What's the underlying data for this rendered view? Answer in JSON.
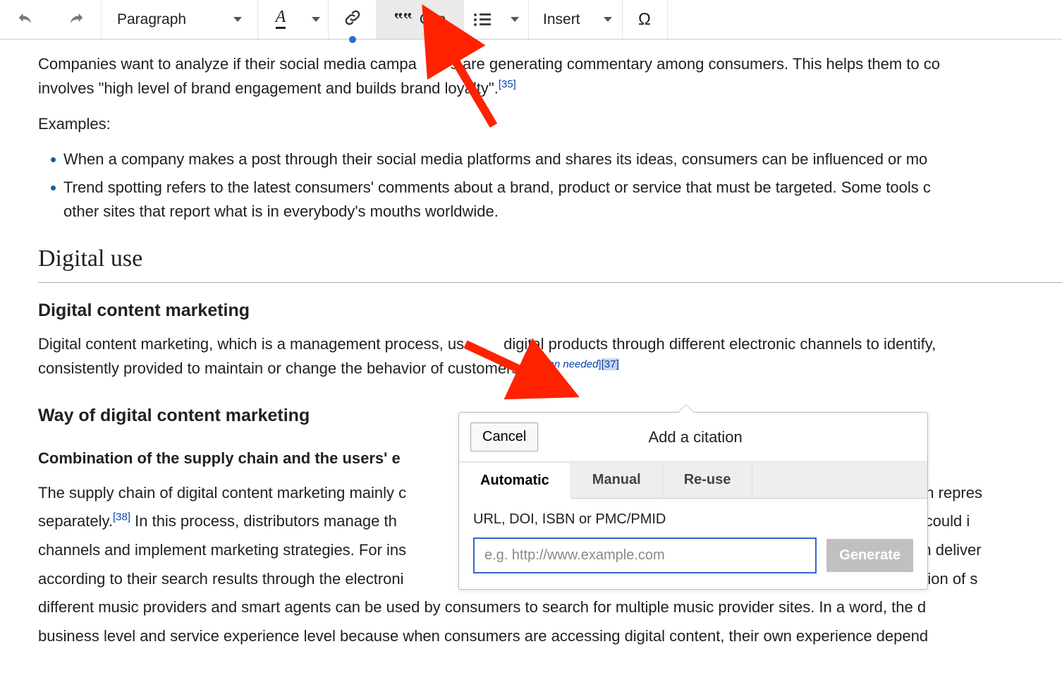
{
  "toolbar": {
    "paragraph_label": "Paragraph",
    "cite_label": "Cite",
    "insert_label": "Insert",
    "format_letter": "A",
    "omega": "Ω"
  },
  "content": {
    "para1_a": "Companies want to analyze if their social media campa",
    "para1_b": "s are generating commentary among consumers. This helps them to co",
    "para2": "involves \"high level of brand engagement and builds brand loyalty\".",
    "ref35": "[35]",
    "examples_label": "Examples:",
    "bullet1": "When a company makes a post through their social media platforms and shares its ideas, consumers can be influenced or mo",
    "bullet2_a": "Trend spotting refers to the latest consumers' comments about a brand, product or service that must be targeted. Some tools c",
    "bullet2_b": "other sites that report what is in everybody's mouths worldwide.",
    "h2_digital_use": "Digital use",
    "h3_dcm": "Digital content marketing",
    "dcm_para_a": "Digital content marketing, which is a management process, us",
    "dcm_para_b": "digital products through different electronic channels to identify,",
    "dcm_para_c": "consistently provided to maintain or change the behavior of customers.",
    "cn_left": "[",
    "cn_text": "citation needed",
    "cn_right": "]",
    "ref37": "[37]",
    "h3_way": "Way of digital content marketing",
    "h4_combo": "Combination of the supply chain and the users' e",
    "supply_a": "The supply chain of digital content marketing mainly c",
    "supply_a2": "hich repres",
    "supply_b": "separately.",
    "ref38": "[38]",
    "supply_b2": " In this process, distributors manage th",
    "supply_b3": "tors could i",
    "supply_c": "channels and implement marketing strategies. For ins",
    "supply_c2": "an deliver",
    "supply_d": "according to their search results through the electroni",
    "supply_d2": "isition of s",
    "supply_e": "different music providers and smart agents can be used by consumers to search for multiple music provider sites. In a word, the d",
    "supply_f": "business level and service experience level because when consumers are accessing digital content, their own experience depend"
  },
  "dialog": {
    "title": "Add a citation",
    "cancel": "Cancel",
    "tab_auto": "Automatic",
    "tab_manual": "Manual",
    "tab_reuse": "Re-use",
    "input_label": "URL, DOI, ISBN or PMC/PMID",
    "input_placeholder": "e.g. http://www.example.com",
    "generate": "Generate"
  }
}
